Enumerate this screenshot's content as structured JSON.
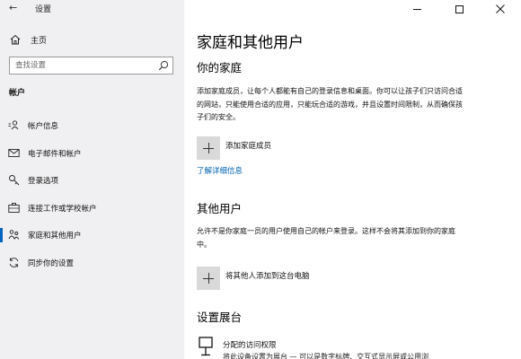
{
  "window": {
    "title": "设置"
  },
  "sidebar": {
    "home_label": "主页",
    "search_placeholder": "查找设置",
    "section_label": "帐户",
    "items": [
      {
        "label": "帐户信息",
        "icon": "account-info-icon",
        "selected": false
      },
      {
        "label": "电子邮件和帐户",
        "icon": "mail-icon",
        "selected": false
      },
      {
        "label": "登录选项",
        "icon": "key-icon",
        "selected": false
      },
      {
        "label": "连接工作或学校帐户",
        "icon": "briefcase-icon",
        "selected": false
      },
      {
        "label": "家庭和其他用户",
        "icon": "family-icon",
        "selected": true
      },
      {
        "label": "同步你的设置",
        "icon": "sync-icon",
        "selected": false
      }
    ]
  },
  "main": {
    "title": "家庭和其他用户",
    "family": {
      "heading": "你的家庭",
      "description": "添加家庭成员，让每个人都能有自己的登录信息和桌面。你可以让孩子们只访问合适的网站，只能使用合适的应用，只能玩合适的游戏，并且设置时间限制，从而确保孩子们的安全。",
      "add_label": "添加家庭成员",
      "learn_more": "了解详细信息"
    },
    "others": {
      "heading": "其他用户",
      "description": "允许不是你家庭一员的用户使用自己的帐户来登录。这样不会将其添加到你的家庭中。",
      "add_label": "将其他人添加到这台电脑"
    },
    "kiosk": {
      "heading": "设置展台",
      "title": "分配的访问权限",
      "description": "将此设备设置为展台 — 可以是数字标牌、交互式显示屏或公用浏"
    }
  },
  "colors": {
    "accent": "#0067c0",
    "link": "#0063b1",
    "sidebar_bg": "#f0f0f2"
  }
}
